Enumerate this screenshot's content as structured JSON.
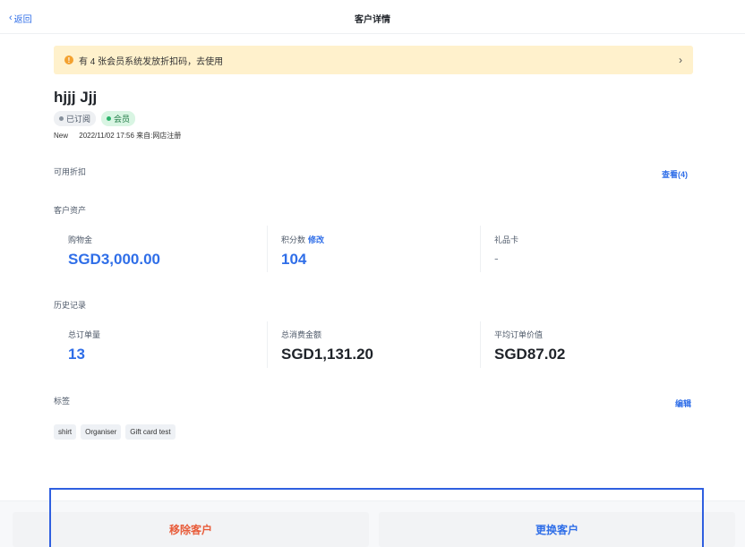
{
  "header": {
    "back_label": "返回",
    "title": "客户详情"
  },
  "banner": {
    "text": "有 4 张会员系统发放折扣码，去使用"
  },
  "customer": {
    "name": "hjjj Jjj",
    "badge_subscribed": "已订阅",
    "badge_member": "会员",
    "status": "New",
    "created": "2022/11/02 17:56 来自:网店注册"
  },
  "discounts": {
    "label": "可用折扣",
    "view_link": "查看(4)"
  },
  "assets": {
    "label": "客户资产",
    "shopping_label": "购物金",
    "shopping_value": "SGD3,000.00",
    "points_label": "积分数",
    "points_edit": "修改",
    "points_value": "104",
    "giftcard_label": "礼品卡",
    "giftcard_value": "-"
  },
  "history": {
    "label": "历史记录",
    "orders_label": "总订单量",
    "orders_value": "13",
    "spend_label": "总消费金额",
    "spend_value": "SGD1,131.20",
    "avg_label": "平均订单价值",
    "avg_value": "SGD87.02"
  },
  "tags": {
    "label": "标签",
    "edit_link": "编辑",
    "items": [
      "shirt",
      "Organiser",
      "Gift card test"
    ]
  },
  "actions": {
    "remove": "移除客户",
    "change": "更换客户"
  },
  "colors": {
    "accent": "#2f6ee8",
    "danger": "#e85c3a",
    "banner_bg": "#fff1cc"
  }
}
